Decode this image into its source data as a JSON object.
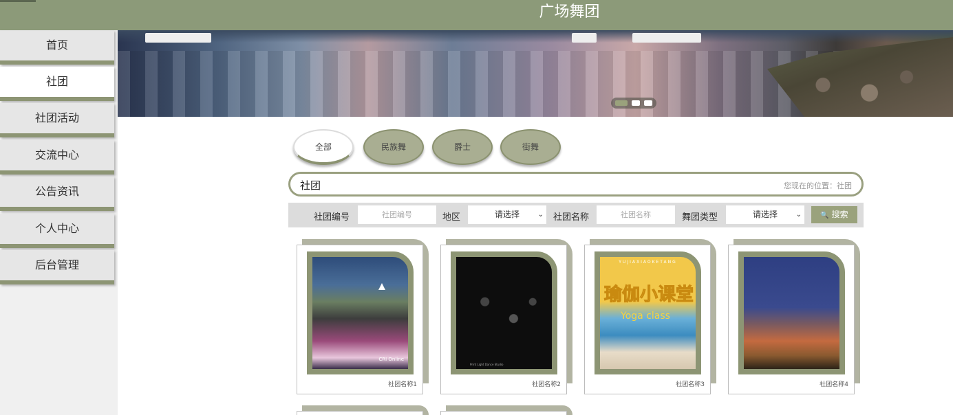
{
  "header": {
    "title": "广场舞团"
  },
  "sidebar": {
    "items": [
      {
        "label": "首页"
      },
      {
        "label": "社团"
      },
      {
        "label": "社团活动"
      },
      {
        "label": "交流中心"
      },
      {
        "label": "公告资讯"
      },
      {
        "label": "个人中心"
      },
      {
        "label": "后台管理"
      }
    ],
    "active": "社团"
  },
  "banner": {
    "slide_count": 3,
    "active_slide": 1
  },
  "categories": {
    "tabs": [
      {
        "label": "全部"
      },
      {
        "label": "民族舞"
      },
      {
        "label": "爵士"
      },
      {
        "label": "街舞"
      }
    ],
    "active": "全部"
  },
  "breadcrumb": {
    "section": "社团",
    "location": "您现在的位置：社团"
  },
  "search": {
    "id_label": "社团编号",
    "id_placeholder": "社团编号",
    "region_label": "地区",
    "region_value": "请选择",
    "name_label": "社团名称",
    "name_placeholder": "社团名称",
    "type_label": "舞团类型",
    "type_value": "请选择",
    "button": "搜索",
    "search_icon": "🔍"
  },
  "cards": [
    {
      "name": "社团名称1",
      "watermark": "CRI Online"
    },
    {
      "name": "社团名称2",
      "watermark": "Print Light Dance Studio"
    },
    {
      "name": "社团名称3",
      "banner_top": "YUJIAXIAOKETANG",
      "headline": "瑜伽小课堂",
      "subline": "Yoga class"
    },
    {
      "name": "社团名称4"
    }
  ],
  "colors": {
    "accent": "#8c9a79",
    "accent_dark": "#8d9574",
    "card_back": "#b2b4a2"
  }
}
